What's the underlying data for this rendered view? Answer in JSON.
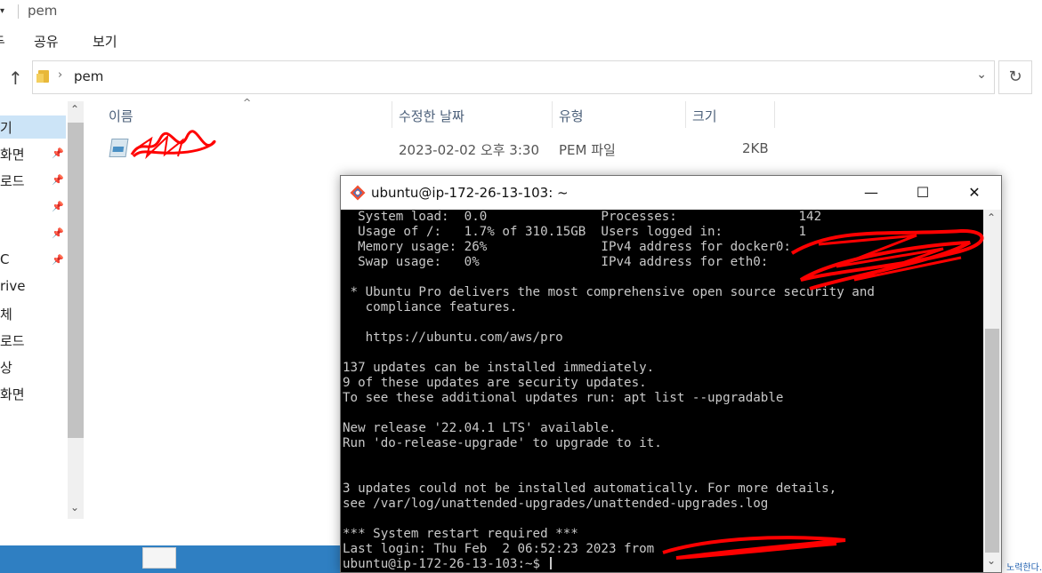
{
  "explorer": {
    "title": "pem",
    "qa_arrow": "▾",
    "ribbon_tabs": [
      "두",
      "공유",
      "보기"
    ],
    "address": {
      "path": "pem",
      "chevron": "›",
      "dropdown": "⌄"
    },
    "up_glyph": "↑",
    "refresh_glyph": "↻",
    "nav_items": [
      {
        "label": "기",
        "pinned": false,
        "selected": true
      },
      {
        "label": "화면",
        "pinned": true,
        "selected": false
      },
      {
        "label": "로드",
        "pinned": true,
        "selected": false
      },
      {
        "label": "",
        "pinned": true,
        "selected": false
      },
      {
        "label": "",
        "pinned": true,
        "selected": false
      },
      {
        "label": "C",
        "pinned": true,
        "selected": false
      },
      {
        "label": "rive",
        "pinned": false,
        "selected": false
      },
      {
        "label": "체",
        "pinned": false,
        "selected": false
      },
      {
        "label": "로드",
        "pinned": false,
        "selected": false
      },
      {
        "label": "상",
        "pinned": false,
        "selected": false
      },
      {
        "label": "화면",
        "pinned": false,
        "selected": false
      }
    ],
    "columns": {
      "name": "이름",
      "date": "수정한 날짜",
      "type": "유형",
      "size": "크기"
    },
    "files": [
      {
        "name": "",
        "date": "2023-02-02 오후 3:30",
        "type": "PEM 파일",
        "size": "2KB"
      }
    ]
  },
  "taskbar": {
    "corner_text": "노력한다."
  },
  "terminal": {
    "title": "ubuntu@ip-172-26-13-103: ~",
    "controls": {
      "minimize": "—",
      "maximize": "☐",
      "close": "✕"
    },
    "lines": [
      "  System load:  0.0               Processes:                142",
      "  Usage of /:   1.7% of 310.15GB  Users logged in:          1",
      "  Memory usage: 26%               IPv4 address for docker0:",
      "  Swap usage:   0%                IPv4 address for eth0:",
      "",
      " * Ubuntu Pro delivers the most comprehensive open source security and",
      "   compliance features.",
      "",
      "   https://ubuntu.com/aws/pro",
      "",
      "137 updates can be installed immediately.",
      "9 of these updates are security updates.",
      "To see these additional updates run: apt list --upgradable",
      "",
      "New release '22.04.1 LTS' available.",
      "Run 'do-release-upgrade' to upgrade to it.",
      "",
      "",
      "3 updates could not be installed automatically. For more details,",
      "see /var/log/unattended-upgrades/unattended-upgrades.log",
      "",
      "*** System restart required ***",
      "Last login: Thu Feb  2 06:52:23 2023 from"
    ],
    "prompt": "ubuntu@ip-172-26-13-103:~$ "
  },
  "colors": {
    "terminal_bg": "#000000",
    "terminal_fg": "#c9c9c9",
    "selection": "#cce4f7",
    "redaction": "#ff0000"
  }
}
